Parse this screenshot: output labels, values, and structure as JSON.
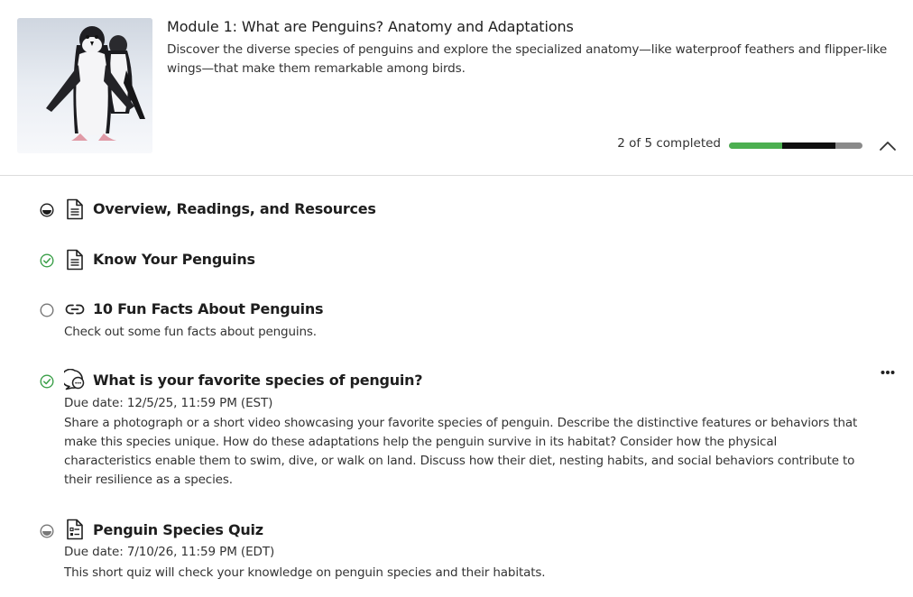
{
  "module": {
    "title": "Module 1: What are Penguins? Anatomy and Adaptations",
    "description": "Discover the diverse species of penguins and explore the specialized anatomy—like waterproof feathers and flipper-like wings—that make them remarkable among birds.",
    "progress_text": "2 of 5 completed",
    "progress": {
      "completed": 2,
      "in_progress": 2,
      "total": 5
    },
    "thumbnail_icon": "penguin-photo",
    "collapse_icon": "chevron-up-icon"
  },
  "colors": {
    "complete": "#4caf50",
    "in_progress": "#0f0f0f",
    "not_started": "#8a8a8a",
    "divider": "#dcdcdc"
  },
  "items": [
    {
      "title": "Overview, Readings, and Resources",
      "status": "in-progress",
      "type_icon": "document-icon"
    },
    {
      "title": "Know Your Penguins",
      "status": "complete",
      "type_icon": "document-icon"
    },
    {
      "title": "10 Fun Facts About Penguins",
      "status": "not-started",
      "type_icon": "link-icon",
      "description": "Check out some fun facts about penguins."
    },
    {
      "title": "What is your favorite species of penguin?",
      "status": "complete",
      "type_icon": "discussion-icon",
      "due": "Due date: 12/5/25, 11:59 PM (EST)",
      "description": "Share a photograph or a short video showcasing your favorite species of penguin. Describe the distinctive features or behaviors that make this species unique. How do these adaptations help the penguin survive in its habitat? Consider how the physical characteristics enable them to swim, dive, or walk on land. Discuss how their diet, nesting habits, and social behaviors contribute to their resilience as a species.",
      "more_icon": "more-options-icon"
    },
    {
      "title": "Penguin Species Quiz",
      "status": "in-progress-gray",
      "type_icon": "quiz-icon",
      "due": "Due date: 7/10/26, 11:59 PM (EDT)",
      "description": "This short quiz will check your knowledge on penguin species and their habitats."
    }
  ]
}
